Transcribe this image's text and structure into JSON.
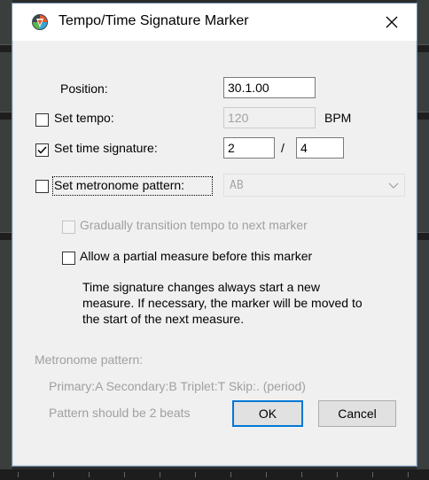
{
  "dialog": {
    "title": "Tempo/Time Signature Marker",
    "close_icon": "close-icon",
    "app_icon": "reaper-logo-icon"
  },
  "position": {
    "label": "Position:",
    "value": "30.1.00"
  },
  "tempo": {
    "label": "Set tempo:",
    "checked": false,
    "value": "120",
    "unit": "BPM"
  },
  "time_signature": {
    "label": "Set time signature:",
    "checked": true,
    "numerator": "2",
    "separator": "/",
    "denominator": "4"
  },
  "metronome_pattern": {
    "label": "Set metronome pattern:",
    "checked": false,
    "value": "AB"
  },
  "gradual_transition": {
    "label": "Gradually transition tempo to next marker",
    "checked": false,
    "enabled": false
  },
  "partial_measure": {
    "label": "Allow a partial measure before this marker",
    "checked": false
  },
  "note_lines": [
    "Time signature changes always start a new",
    "measure. If necessary, the marker will be moved to",
    "the start of the next measure."
  ],
  "metronome_help": {
    "heading": "Metronome pattern:",
    "line1": "Primary:A Secondary:B Triplet:T Skip:. (period)",
    "line2": "Pattern should be 2 beats"
  },
  "buttons": {
    "ok": "OK",
    "cancel": "Cancel"
  },
  "colors": {
    "accent": "#0078d7",
    "disabled_text": "#a0a0a0",
    "dialog_bg": "#f0f0f0"
  }
}
